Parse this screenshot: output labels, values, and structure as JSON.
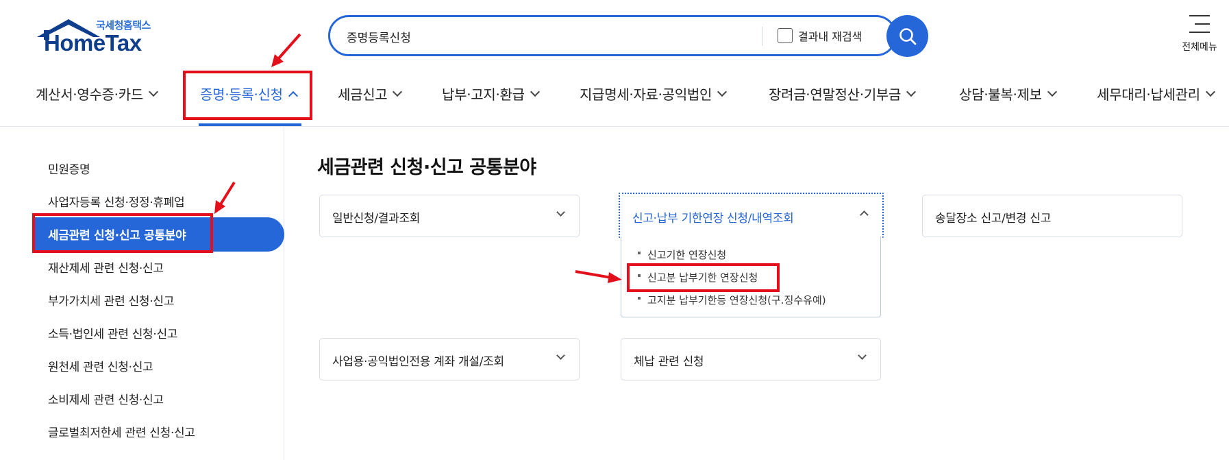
{
  "header": {
    "logo_sub": "국세청홈택스",
    "logo_main": "HomeTax",
    "search_value": "증명등록신청",
    "rescan_label": "결과내 재검색",
    "allmenu_label": "전체메뉴"
  },
  "nav": {
    "items": [
      {
        "label": "계산서·영수증·카드"
      },
      {
        "label": "증명·등록·신청",
        "active": true
      },
      {
        "label": "세금신고"
      },
      {
        "label": "납부·고지·환급"
      },
      {
        "label": "지급명세·자료·공익법인"
      },
      {
        "label": "장려금·연말정산·기부금"
      },
      {
        "label": "상담·불복·제보"
      },
      {
        "label": "세무대리·납세관리"
      }
    ]
  },
  "sidebar": {
    "items": [
      {
        "label": "민원증명"
      },
      {
        "label": "사업자등록 신청·정정·휴폐업"
      },
      {
        "label": "세금관련 신청·신고 공통분야",
        "active": true
      },
      {
        "label": "재산제세 관련 신청·신고"
      },
      {
        "label": "부가가치세 관련 신청·신고"
      },
      {
        "label": "소득·법인세 관련 신청·신고"
      },
      {
        "label": "원천세 관련 신청·신고"
      },
      {
        "label": "소비제세 관련 신청·신고"
      },
      {
        "label": "글로벌최저한세 관련 신청·신고"
      }
    ]
  },
  "main": {
    "title": "세금관련 신청·신고 공통분야",
    "cards": [
      {
        "label": "일반신청/결과조회"
      },
      {
        "label": "신고·납부 기한연장 신청/내역조회",
        "open": true
      },
      {
        "label": "송달장소 신고/변경 신고"
      },
      {
        "label": "사업용·공익법인전용 계좌 개설/조회"
      },
      {
        "label": "체납 관련 신청"
      }
    ],
    "dropdown_items": [
      {
        "label": "신고기한 연장신청"
      },
      {
        "label": "신고분 납부기한 연장신청",
        "highlighted": true
      },
      {
        "label": "고지분 납부기한등 연장신청(구.징수유예)"
      }
    ]
  },
  "colors": {
    "accent": "#2566d8",
    "logo_dark": "#0f3f8c",
    "annotation_red": "#e3101b"
  }
}
